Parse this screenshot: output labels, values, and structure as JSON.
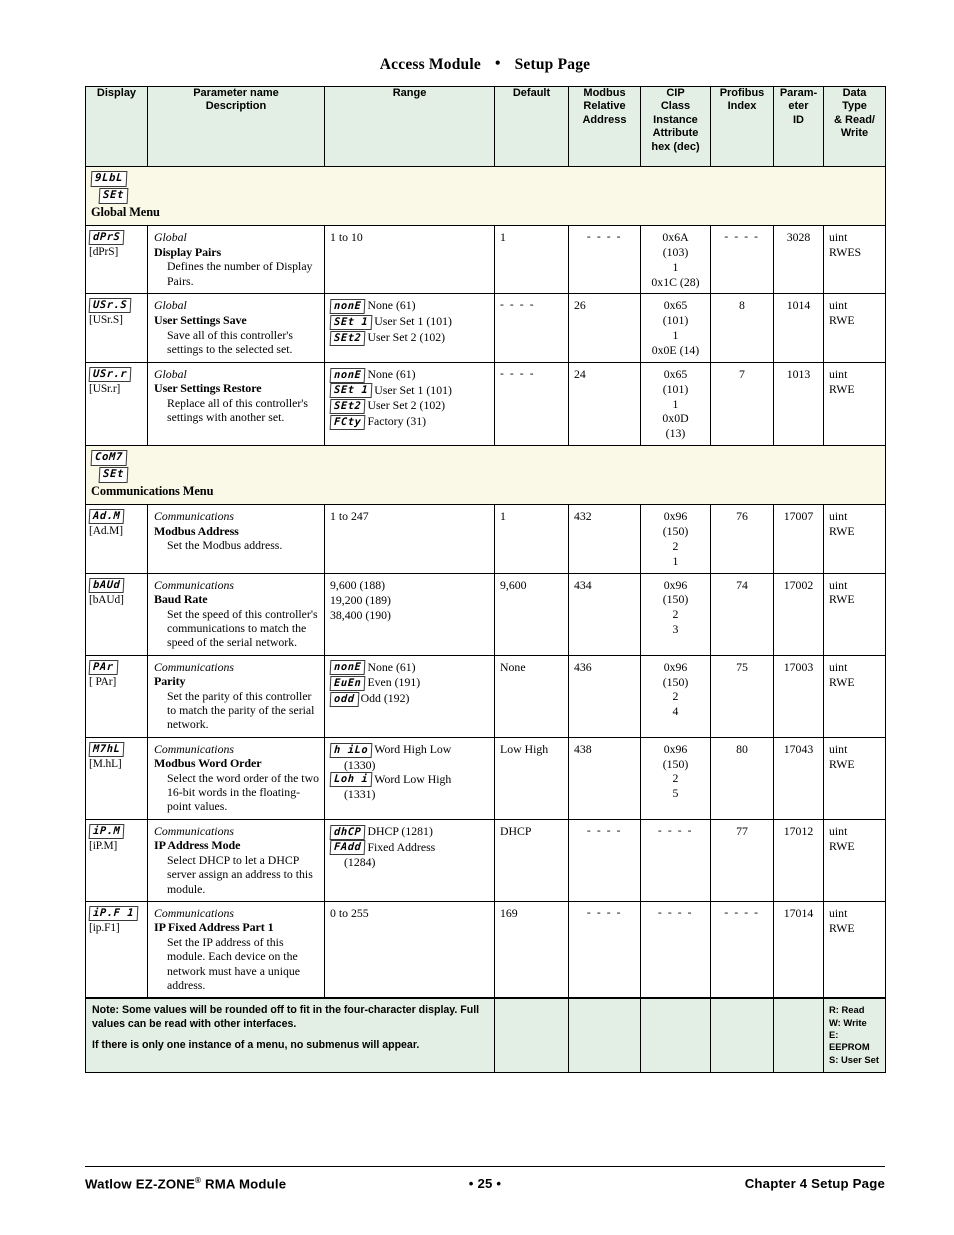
{
  "header": {
    "title_left": "Access Module",
    "title_sep": "•",
    "title_right": "Setup Page"
  },
  "table": {
    "columns": [
      {
        "key": "display",
        "label_lines": [
          "Display"
        ]
      },
      {
        "key": "param",
        "label_lines": [
          "Parameter name",
          "Description"
        ]
      },
      {
        "key": "range",
        "label_lines": [
          "Range"
        ]
      },
      {
        "key": "default",
        "label_lines": [
          "Default"
        ]
      },
      {
        "key": "modbus",
        "label_lines": [
          "Modbus",
          "Relative",
          "Address"
        ]
      },
      {
        "key": "cip",
        "label_lines": [
          "CIP",
          "Class",
          "Instance",
          "Attribute",
          "hex (dec)"
        ]
      },
      {
        "key": "profibus",
        "label_lines": [
          "Profibus",
          "Index"
        ]
      },
      {
        "key": "paramid",
        "label_lines": [
          "Param-",
          "eter",
          "ID"
        ]
      },
      {
        "key": "dtype",
        "label_lines": [
          "Data",
          "Type",
          "& Read/",
          "Write"
        ]
      }
    ],
    "col_display": "Display",
    "col_param_1": "Parameter name",
    "col_param_2": "Description",
    "col_range": "Range",
    "col_default": "Default",
    "col_modbus_1": "Modbus",
    "col_modbus_2": "Relative",
    "col_modbus_3": "Address",
    "col_cip_1": "CIP",
    "col_cip_2": "Class",
    "col_cip_3": "Instance",
    "col_cip_4": "Attribute",
    "col_cip_5": "hex (dec)",
    "col_profibus_1": "Profibus",
    "col_profibus_2": "Index",
    "col_pid_1": "Param-",
    "col_pid_2": "eter",
    "col_pid_3": "ID",
    "col_dtype_1": "Data",
    "col_dtype_2": "Type",
    "col_dtype_3": "& Read/",
    "col_dtype_4": "Write"
  },
  "sections": [
    {
      "id": "global",
      "seg_line1": "9LbL",
      "seg_line2": "SEt",
      "title": "Global Menu"
    },
    {
      "id": "communications",
      "seg_line1": "CoM7",
      "seg_line2": "SEt",
      "title": "Communications Menu"
    }
  ],
  "rows": [
    {
      "id": "display-pairs",
      "display_seg": "dPrS",
      "display_alt": "[dPrS]",
      "group": "Global",
      "name": "Display Pairs",
      "desc": "Defines the number of Display Pairs.",
      "range_text": "1 to 10",
      "range_options": [],
      "default": "1",
      "modbus": "- - - -",
      "cip": [
        "0x6A",
        "(103)",
        "1",
        "0x1C (28)"
      ],
      "profibus": "- - - -",
      "paramid": "3028",
      "dtype_type": "uint",
      "dtype_rw": "RWES"
    },
    {
      "id": "user-settings-save",
      "display_seg": "USr.S",
      "display_alt": "[USr.S]",
      "group": "Global",
      "name": "User Settings Save",
      "desc": "Save all of this controller's settings to the selected set.",
      "range_text": "",
      "range_options": [
        {
          "seg": "nonE",
          "label": "None (61)"
        },
        {
          "seg": "SEt 1",
          "label": "User Set 1 (101)"
        },
        {
          "seg": "SEt2",
          "label": "User Set 2 (102)"
        }
      ],
      "default": "- - - -",
      "modbus": "26",
      "cip": [
        "0x65",
        "(101)",
        "1",
        "0x0E (14)"
      ],
      "profibus": "8",
      "paramid": "1014",
      "dtype_type": "uint",
      "dtype_rw": "RWE"
    },
    {
      "id": "user-settings-restore",
      "display_seg": "USr.r",
      "display_alt": "[USr.r]",
      "group": "Global",
      "name": "User Settings Restore",
      "desc": "Replace all of this controller's settings with another set.",
      "range_text": "",
      "range_options": [
        {
          "seg": "nonE",
          "label": "None (61)"
        },
        {
          "seg": "SEt 1",
          "label": "User Set 1 (101)"
        },
        {
          "seg": "SEt2",
          "label": "User Set 2 (102)"
        },
        {
          "seg": "FCty",
          "label": "Factory (31)"
        }
      ],
      "default": "- - - -",
      "modbus": "24",
      "cip": [
        "0x65",
        "(101)",
        "1",
        "0x0D",
        "(13)"
      ],
      "profibus": "7",
      "paramid": "1013",
      "dtype_type": "uint",
      "dtype_rw": "RWE"
    },
    {
      "id": "modbus-address",
      "display_seg": "Ad.M",
      "display_alt": "[Ad.M]",
      "group": "Communications",
      "name": "Modbus Address",
      "desc": "Set the Modbus address.",
      "range_text": "1 to 247",
      "range_options": [],
      "default": "1",
      "modbus": "432",
      "cip": [
        "0x96",
        "(150)",
        "2",
        "1"
      ],
      "profibus": "76",
      "paramid": "17007",
      "dtype_type": "uint",
      "dtype_rw": "RWE"
    },
    {
      "id": "baud-rate",
      "display_seg": "bAUd",
      "display_alt": "[bAUd]",
      "group": "Communications",
      "name": "Baud Rate",
      "desc": "Set the speed of this controller's communications to match the speed of the serial network.",
      "range_text": "",
      "range_lines": [
        "9,600 (188)",
        "19,200 (189)",
        "38,400 (190)"
      ],
      "range_options": [],
      "default": "9,600",
      "modbus": "434",
      "cip": [
        "0x96",
        "(150)",
        "2",
        "3"
      ],
      "profibus": "74",
      "paramid": "17002",
      "dtype_type": "uint",
      "dtype_rw": "RWE"
    },
    {
      "id": "parity",
      "display_seg": "PAr",
      "display_alt": "[ PAr]",
      "group": "Communications",
      "name": "Parity",
      "desc": "Set the parity of this controller to match the parity of the serial network.",
      "range_text": "",
      "range_options": [
        {
          "seg": "nonE",
          "label": "None (61)"
        },
        {
          "seg": "EuEn",
          "label": "Even (191)"
        },
        {
          "seg": "odd",
          "label": "Odd (192)"
        }
      ],
      "default": "None",
      "modbus": "436",
      "cip": [
        "0x96",
        "(150)",
        "2",
        "4"
      ],
      "profibus": "75",
      "paramid": "17003",
      "dtype_type": "uint",
      "dtype_rw": "RWE"
    },
    {
      "id": "modbus-word-order",
      "display_seg": "M7hL",
      "display_alt": "[M.hL]",
      "group": "Communications",
      "name": "Modbus Word Order",
      "desc": "Select the word order of the two 16-bit words in the floating-point values.",
      "range_text": "",
      "range_options": [
        {
          "seg": "h iLo",
          "label": "Word High Low",
          "sub": "(1330)"
        },
        {
          "seg": "Loh i",
          "label": "Word Low High",
          "sub": "(1331)"
        }
      ],
      "default": "Low High",
      "modbus": "438",
      "cip": [
        "0x96",
        "(150)",
        "2",
        "5"
      ],
      "profibus": "80",
      "paramid": "17043",
      "dtype_type": "uint",
      "dtype_rw": "RWE"
    },
    {
      "id": "ip-address-mode",
      "display_seg": "iP.M",
      "display_alt": "[iP.M]",
      "group": "Communications",
      "name": "IP Address Mode",
      "desc": "Select DHCP to let a DHCP server assign an address to this module.",
      "range_text": "",
      "range_options": [
        {
          "seg": "dhCP",
          "label": "DHCP (1281)"
        },
        {
          "seg": "FAdd",
          "label": "Fixed Address",
          "sub": "(1284)"
        }
      ],
      "default": "DHCP",
      "modbus": "- - - -",
      "cip": [
        "- - - -"
      ],
      "profibus": "77",
      "paramid": "17012",
      "dtype_type": "uint",
      "dtype_rw": "RWE"
    },
    {
      "id": "ip-fixed-address-part-1",
      "display_seg": "iP.F 1",
      "display_alt": "[ip.F1]",
      "group": "Communications",
      "name": "IP Fixed Address Part 1",
      "desc": "Set the IP address of this module. Each device on the network must have a unique address.",
      "range_text": "0 to 255",
      "range_options": [],
      "default": "169",
      "modbus": "- - - -",
      "cip": [
        "- - - -"
      ],
      "profibus": "- - - -",
      "paramid": "17014",
      "dtype_type": "uint",
      "dtype_rw": "RWE"
    }
  ],
  "note": {
    "line1": "Note: Some values will be rounded off to fit in the four-character display. Full values can be read with other interfaces.",
    "line2": "If there is only one instance of a menu, no submenus will appear.",
    "legend": [
      "R: Read",
      "W: Write",
      "E: EEPROM",
      "S: User Set"
    ]
  },
  "footer": {
    "left_pre": "Watlow EZ-ZONE",
    "left_sup": "®",
    "left_post": " RMA Module",
    "center": "•  25  •",
    "right": "Chapter 4 Setup Page"
  },
  "colors": {
    "header_bg": "#e3efe4",
    "section_bg": "#faf8e7",
    "note_bg": "#e3efe4",
    "border": "#000000",
    "text": "#000000"
  }
}
